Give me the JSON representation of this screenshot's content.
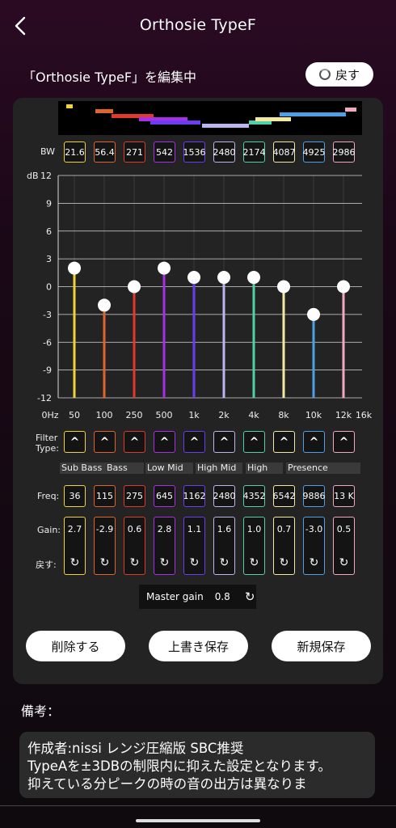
{
  "header": {
    "title": "Orthosie TypeF",
    "back_icon": "chevron-left-icon"
  },
  "editing_label": "「Orthosie TypeF」を編集中",
  "reset_button": {
    "label": "戻す",
    "icon": "reset-icon"
  },
  "bands": [
    {
      "color": "#f0d23c",
      "bw": "21.6",
      "freq_axis": "50",
      "freq": "36",
      "gain": "2.7",
      "gain_value": 2.0
    },
    {
      "color": "#e0652d",
      "bw": "56.4",
      "freq_axis": "100",
      "freq": "115",
      "gain": "-2.9",
      "gain_value": -2.0
    },
    {
      "color": "#e03a2a",
      "bw": "271",
      "freq_axis": "250",
      "freq": "275",
      "gain": "0.6",
      "gain_value": 0.0
    },
    {
      "color": "#a92ee8",
      "bw": "542",
      "freq_axis": "500",
      "freq": "645",
      "gain": "2.8",
      "gain_value": 2.0
    },
    {
      "color": "#6b3cf0",
      "bw": "1536",
      "freq_axis": "1k",
      "freq": "1162",
      "gain": "1.1",
      "gain_value": 1.0
    },
    {
      "color": "#b9b6f0",
      "bw": "2480",
      "freq_axis": "2k",
      "freq": "2480",
      "gain": "1.6",
      "gain_value": 1.0
    },
    {
      "color": "#4fd0a6",
      "bw": "2174",
      "freq_axis": "4k",
      "freq": "4352",
      "gain": "1.0",
      "gain_value": 1.0
    },
    {
      "color": "#f4e9a0",
      "bw": "4087",
      "freq_axis": "8k",
      "freq": "6542",
      "gain": "0.7",
      "gain_value": 0.0
    },
    {
      "color": "#4f9fe6",
      "bw": "4925",
      "freq_axis": "10k",
      "freq": "9886",
      "gain": "-3.0",
      "gain_value": -3.0
    },
    {
      "color": "#f2a8c0",
      "bw": "2986",
      "freq_axis": "12k",
      "freq": "13 K",
      "gain": "0.5",
      "gain_value": 0.0
    }
  ],
  "labels": {
    "bw": "BW",
    "db": "dB",
    "zero_hz": "0Hz",
    "max_hz": "16k",
    "filter_type": "Filter\nType:",
    "freq": "Freq:",
    "gain": "Gain:",
    "reset_row": "戻す:"
  },
  "filter_type_symbol": "^",
  "y_ticks": [
    "12",
    "9",
    "6",
    "3",
    "0",
    "-3",
    "-6",
    "-9",
    "-12"
  ],
  "chart_data": {
    "type": "scatter",
    "x": [
      "50",
      "100",
      "250",
      "500",
      "1k",
      "2k",
      "4k",
      "8k",
      "10k",
      "12k"
    ],
    "y": [
      2,
      -2,
      0,
      2,
      1,
      1,
      1,
      0,
      -3,
      0
    ],
    "ylabel": "dB",
    "ylim": [
      -12,
      12
    ],
    "grid": true
  },
  "band_names": [
    "Sub Bass",
    "Bass",
    "Low Mid",
    "High Mid",
    "High",
    "Presence"
  ],
  "master_gain": {
    "label": "Master gain",
    "value": "0.8"
  },
  "actions": {
    "delete": "削除する",
    "overwrite": "上書き保存",
    "save_new": "新規保存"
  },
  "notes": {
    "label": "備考：",
    "text": "作成者:nissi レンジ圧縮版 SBC推奨\nTypeAを±3DBの制限内に抑えた設定となります。\n抑えている分ピークの時の音の出方は異なりま"
  }
}
